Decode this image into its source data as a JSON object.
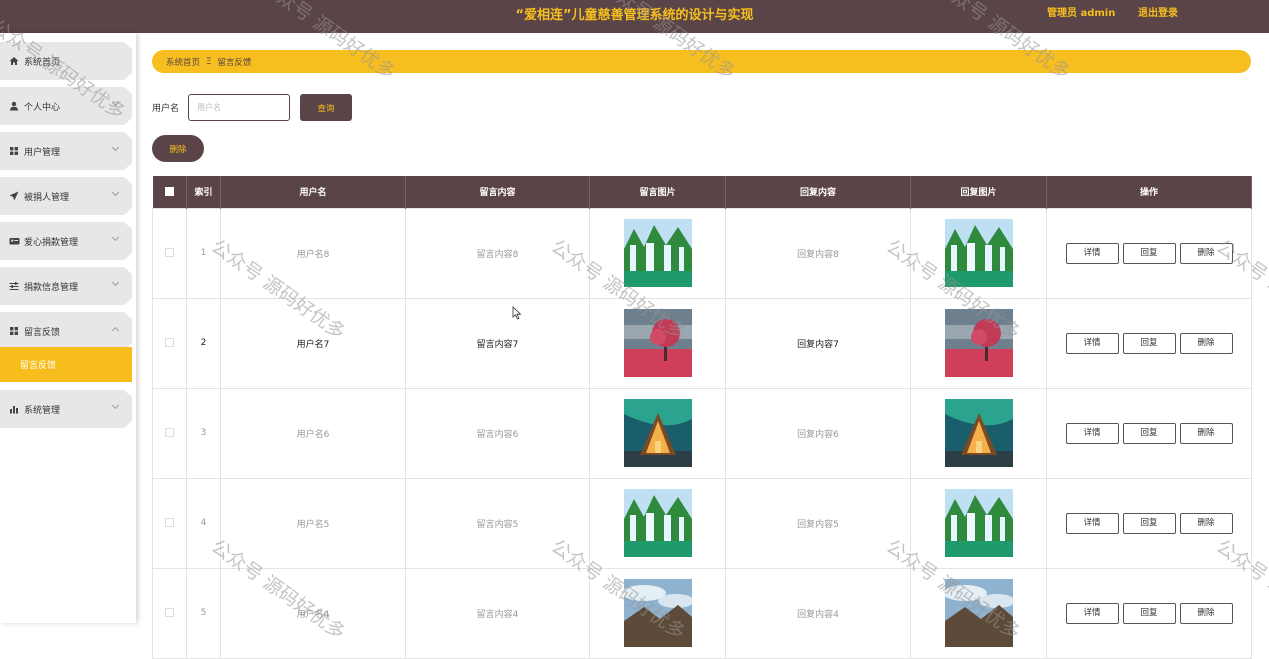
{
  "header": {
    "title": "“爱相连”儿童慈善管理系统的设计与实现",
    "admin": "管理员 admin",
    "logout": "退出登录"
  },
  "sidebar": {
    "items": [
      {
        "label": "系统首页",
        "icon": "home-icon"
      },
      {
        "label": "个人中心",
        "icon": "user-icon"
      },
      {
        "label": "用户管理",
        "icon": "grid-icon"
      },
      {
        "label": "被捐人管理",
        "icon": "send-icon"
      },
      {
        "label": "爱心捐款管理",
        "icon": "id-card-icon"
      },
      {
        "label": "捐款信息管理",
        "icon": "sliders-icon"
      },
      {
        "label": "留言反馈",
        "icon": "grid-icon"
      },
      {
        "label": "系统管理",
        "icon": "bar-chart-icon"
      }
    ],
    "submenu_label": "留言反馈"
  },
  "breadcrumb": {
    "home": "系统首页",
    "separator": "Ξ",
    "current": "留言反馈"
  },
  "search": {
    "label": "用户名",
    "placeholder": "用户名",
    "button": "查询"
  },
  "delete_button": "删除",
  "table": {
    "headers": [
      "索引",
      "用户名",
      "留言内容",
      "留言图片",
      "回复内容",
      "回复图片",
      "操作"
    ],
    "rows": [
      {
        "index": "1",
        "username": "用户名8",
        "message": "留言内容8",
        "reply": "回复内容8",
        "image": "waterfall"
      },
      {
        "index": "2",
        "username": "用户名7",
        "message": "留言内容7",
        "reply": "回复内容7",
        "image": "pink-tree"
      },
      {
        "index": "3",
        "username": "用户名6",
        "message": "留言内容6",
        "reply": "回复内容6",
        "image": "aurora-cabin"
      },
      {
        "index": "4",
        "username": "用户名5",
        "message": "留言内容5",
        "reply": "回复内容5",
        "image": "waterfall"
      },
      {
        "index": "5",
        "username": "用户名4",
        "message": "留言内容4",
        "reply": "回复内容4",
        "image": "mountain-sky"
      }
    ],
    "actions": {
      "detail": "详情",
      "reply": "回复",
      "delete": "删除"
    }
  },
  "watermark": "公众号 源码好优多",
  "colors": {
    "brand_dark": "#5b4447",
    "accent_yellow": "#f6bf1f"
  }
}
